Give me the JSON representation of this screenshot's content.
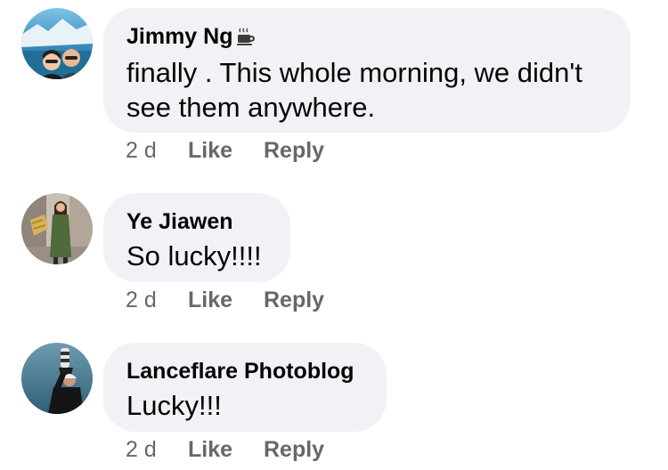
{
  "comments": [
    {
      "author": "Jimmy Ng",
      "badge_icon": "coffee-cup-icon",
      "text": "finally . This whole morning, we didn't see them anywhere.",
      "time": "2 d",
      "like_label": "Like",
      "reply_label": "Reply"
    },
    {
      "author": "Ye Jiawen",
      "text": "So lucky!!!!",
      "time": "2 d",
      "like_label": "Like",
      "reply_label": "Reply"
    },
    {
      "author": "Lanceflare Photoblog",
      "text": "Lucky!!!",
      "time": "2 d",
      "like_label": "Like",
      "reply_label": "Reply"
    }
  ],
  "colors": {
    "bubble_background": "#f0f2f5",
    "name_text": "#050505",
    "action_text": "#65676b"
  }
}
